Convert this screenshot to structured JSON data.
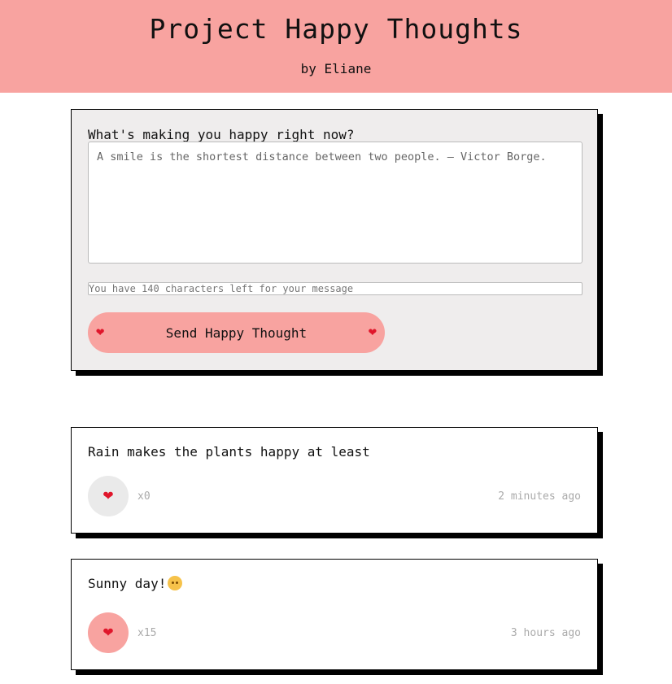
{
  "header": {
    "title": "Project Happy Thoughts",
    "byline": "by Eliane"
  },
  "form": {
    "label": "What's making you happy right now?",
    "textarea_value": "",
    "textarea_placeholder": "A smile is the shortest distance between two people. – Victor Borge.",
    "counter_placeholder": "You have 140 characters left for your message",
    "send_label": "Send Happy Thought",
    "heart_glyph": "❤",
    "heart_color": "#e0162b"
  },
  "thoughts": [
    {
      "message": "Rain makes the plants happy at least",
      "heart_glyph": "❤",
      "likes": "x0",
      "time": "2 minutes ago",
      "liked": false
    },
    {
      "message": "Sunny day!",
      "emoji_icon": "sun-with-face-icon",
      "heart_glyph": "❤",
      "likes": "x15",
      "time": "3 hours ago",
      "liked": true
    }
  ],
  "colors": {
    "accent": "#f8a3a0",
    "form_background": "#efeded",
    "like_inactive": "#eaeaea",
    "muted_text": "#aaaaaa"
  }
}
